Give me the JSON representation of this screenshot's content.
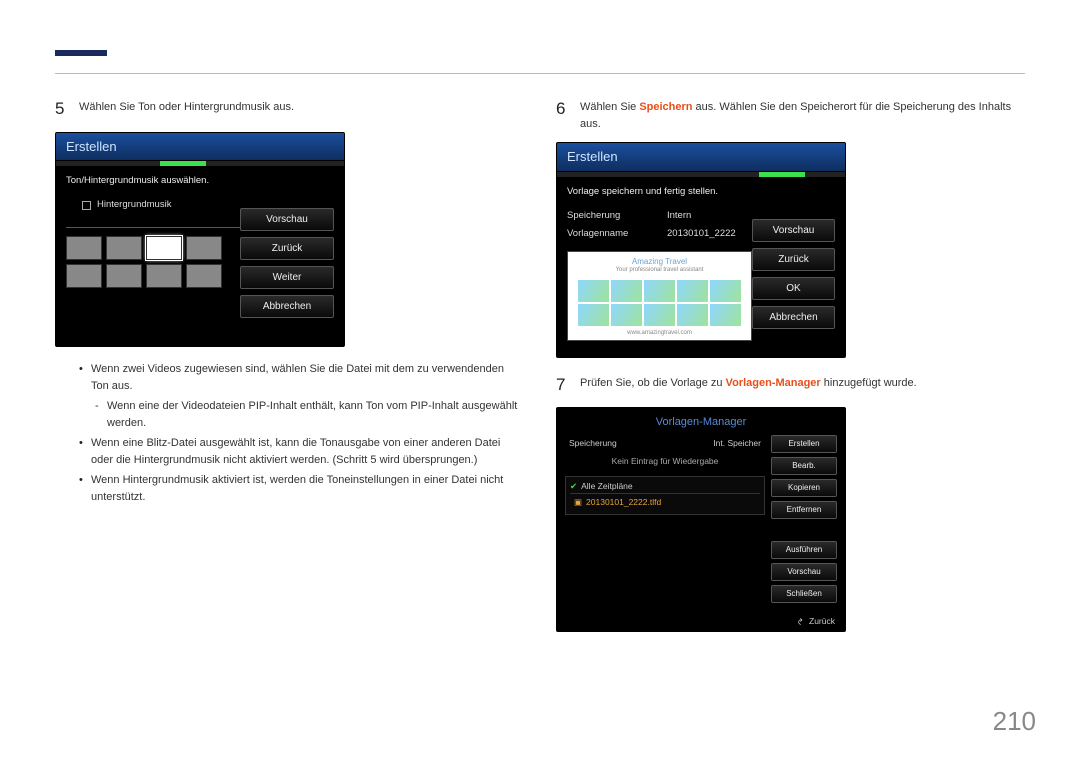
{
  "page_number": "210",
  "left": {
    "step5": {
      "num": "5",
      "text": "Wählen Sie Ton oder Hintergrundmusik aus."
    },
    "screenshot5": {
      "title": "Erstellen",
      "subtitle": "Ton/Hintergrundmusik auswählen.",
      "checkbox_label": "Hintergrundmusik",
      "buttons": [
        "Vorschau",
        "Zurück",
        "Weiter",
        "Abbrechen"
      ]
    },
    "bullets": [
      {
        "pre": "Wenn zwei ",
        "hl": "Videos",
        "post": " zugewiesen sind, wählen Sie die Datei mit dem zu verwendenden Ton aus."
      },
      {
        "sub": true,
        "pre": "Wenn eine der Videodateien ",
        "hl": "PIP",
        "mid": "-Inhalt enthält, kann Ton vom ",
        "hl2": "PIP",
        "post": "-Inhalt ausgewählt werden."
      },
      {
        "pre": "Wenn eine ",
        "hl": "Blitz",
        "post": "-Datei ausgewählt ist, kann die Tonausgabe von einer anderen Datei oder die Hintergrundmusik nicht aktiviert werden. (Schritt 5 wird übersprungen.)"
      },
      {
        "pre": "Wenn ",
        "hl": "Hintergrundmusik",
        "post": " aktiviert ist, werden die Toneinstellungen in einer Datei nicht unterstützt."
      }
    ]
  },
  "right": {
    "step6": {
      "num": "6",
      "pre": "Wählen Sie ",
      "hl": "Speichern",
      "post": " aus. Wählen Sie den Speicherort für die Speicherung des Inhalts aus."
    },
    "screenshot6": {
      "title": "Erstellen",
      "subtitle": "Vorlage speichern und fertig stellen.",
      "fields": [
        {
          "label": "Speicherung",
          "value": "Intern"
        },
        {
          "label": "Vorlagenname",
          "value": "20130101_2222"
        }
      ],
      "preview_brand": "Amazing Travel",
      "preview_tagline": "Your professional travel assistant",
      "preview_url": "www.amazingtravel.com",
      "buttons": [
        "Vorschau",
        "Zurück",
        "OK",
        "Abbrechen"
      ]
    },
    "step7": {
      "num": "7",
      "pre": "Prüfen Sie, ob die Vorlage zu ",
      "hl": "Vorlagen-Manager",
      "post": " hinzugefügt wurde."
    },
    "screenshot7": {
      "title": "Vorlagen-Manager",
      "storage_label": "Speicherung",
      "storage_value": "Int. Speicher",
      "no_entry": "Kein Eintrag für Wiedergabe",
      "section_label": "Alle Zeitpläne",
      "item": "20130101_2222.tlfd",
      "buttons_top": [
        "Erstellen",
        "Bearb.",
        "Kopieren",
        "Entfernen"
      ],
      "buttons_bottom": [
        "Ausführen",
        "Vorschau",
        "Schließen"
      ],
      "back": "Zurück"
    }
  }
}
